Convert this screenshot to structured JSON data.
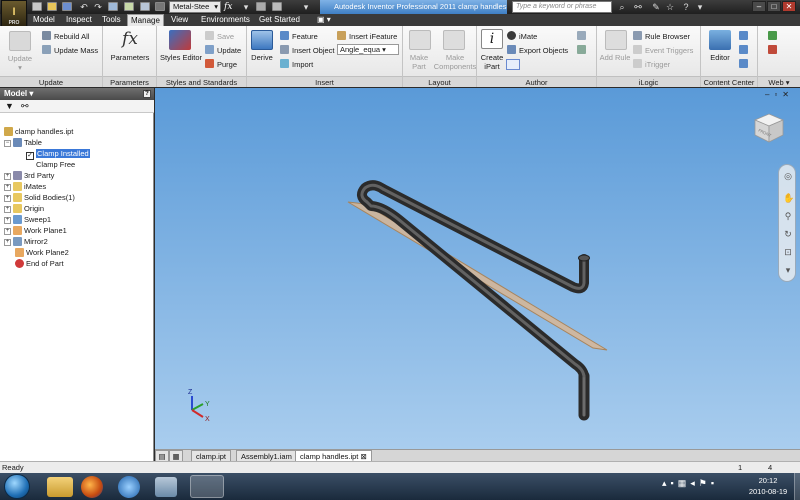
{
  "title_bar": {
    "material": "Metal-Stee",
    "fx": "fx",
    "window_title": "Autodesk Inventor Professional 2011    clamp handles.ipt",
    "search_placeholder": "Type a keyword or phrase",
    "app_badge": "PRO"
  },
  "ribbon_tabs": [
    "Model",
    "Inspect",
    "Tools",
    "Manage",
    "View",
    "Environments",
    "Get Started"
  ],
  "active_tab": "Manage",
  "ribbon": {
    "update": {
      "title": "Update",
      "update": "Update",
      "rebuild_all": "Rebuild All",
      "update_mass": "Update Mass"
    },
    "parameters": {
      "title": "Parameters",
      "parameters": "Parameters",
      "icon_text": "fx"
    },
    "styles": {
      "title": "Styles and Standards",
      "styles_editor": "Styles Editor",
      "save": "Save",
      "update": "Update",
      "purge": "Purge"
    },
    "insert": {
      "title": "Insert",
      "derive": "Derive",
      "feature": "Feature",
      "insert_object": "Insert Object",
      "import": "Import",
      "insert_ifeature": "Insert iFeature",
      "angle_combo": "Angle_equa"
    },
    "layout": {
      "title": "Layout",
      "make_part": "Make Part",
      "make_components": "Make Components"
    },
    "author": {
      "title": "Author",
      "create_ipart": "Create iPart",
      "imate": "iMate",
      "export_objects": "Export Objects"
    },
    "ilogic": {
      "title": "iLogic",
      "add_rule": "Add Rule",
      "rule_browser": "Rule Browser",
      "event_triggers": "Event Triggers",
      "itrigger": "iTrigger"
    },
    "content_center": {
      "title": "Content Center",
      "editor": "Editor"
    },
    "web": {
      "title": "Web"
    }
  },
  "browser": {
    "title": "Model",
    "help": "?",
    "tree": [
      {
        "label": "clamp handles.ipt"
      },
      {
        "label": "Table"
      },
      {
        "label": "Clamp Installed"
      },
      {
        "label": "Clamp Free"
      },
      {
        "label": "3rd Party"
      },
      {
        "label": "iMates"
      },
      {
        "label": "Solid Bodies(1)"
      },
      {
        "label": "Origin"
      },
      {
        "label": "Sweep1"
      },
      {
        "label": "Work Plane1"
      },
      {
        "label": "Mirror2"
      },
      {
        "label": "Work Plane2"
      },
      {
        "label": "End of Part"
      }
    ]
  },
  "viewcube": {
    "face": "FRONT"
  },
  "doc_tabs": [
    "clamp.ipt",
    "Assembly1.iam",
    "clamp handles.ipt"
  ],
  "active_doc": "clamp handles.ipt",
  "status": {
    "text": "Ready",
    "num1": "1",
    "num2": "4"
  },
  "clock": {
    "time": "20:12",
    "date": "2010-08-19"
  },
  "colors": {
    "viewport_top": "#5a9ad8",
    "viewport_bottom": "#a9cdee",
    "selection": "#3a78d8",
    "title_active": "#3f7fc4"
  }
}
